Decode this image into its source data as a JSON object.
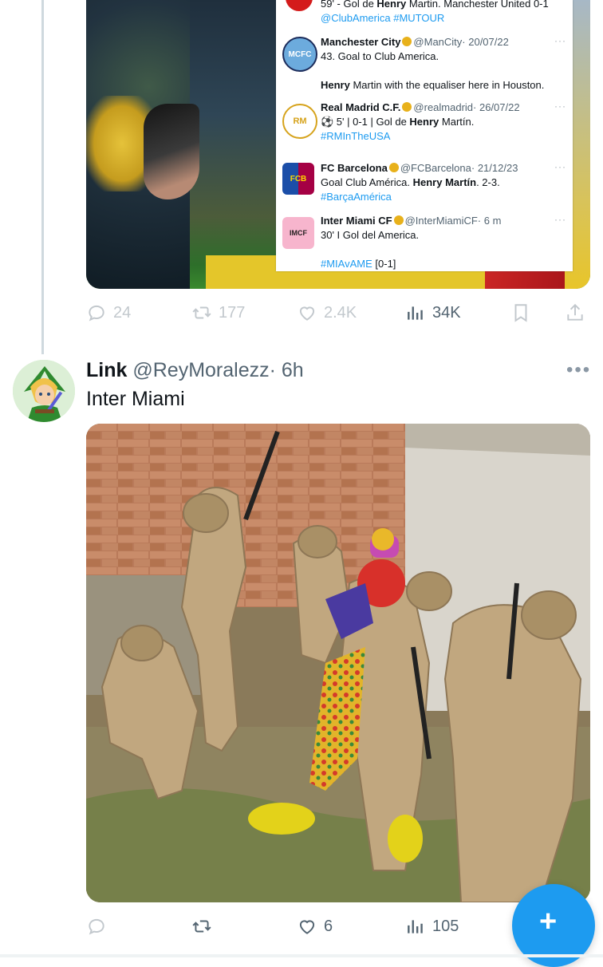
{
  "embedded_card": {
    "posts": [
      {
        "line1_prefix": "59' - Gol de ",
        "line1_bold": "Henry",
        "line1_rest": " Martin. Manchester United 0-1",
        "line2": "@ClubAmerica #MUTOUR"
      },
      {
        "logo_text": "MCFC",
        "name": "Manchester City",
        "handle": "@ManCity",
        "date": "· 20/07/22",
        "dots": "···",
        "line1": "43. Goal to Club America.",
        "line2_bold": "Henry",
        "line2_rest": " Martin with the equaliser here in Houston."
      },
      {
        "logo_text": "RM",
        "name": "Real Madrid C.F.",
        "handle": "@realmadrid",
        "date": "· 26/07/22",
        "dots": "···",
        "line1_prefix": "⚽ 5' | 0-1 | Gol de ",
        "line1_bold": "Henry",
        "line1_rest": " Martín.",
        "line2": "#RMInTheUSA"
      },
      {
        "logo_text": "FCB",
        "name": "FC Barcelona",
        "handle": "@FCBarcelona",
        "date": "· 21/12/23",
        "dots": "···",
        "line1_prefix": "Goal Club América. ",
        "line1_bold": "Henry Martín",
        "line1_rest": ". 2-3.",
        "line2": "#BarçaAmérica"
      },
      {
        "logo_text": "IMCF",
        "name": "Inter Miami CF",
        "handle": "@InterMiamiCF",
        "date": "· 6 m",
        "dots": "···",
        "line1": "30' I Gol del America.",
        "line2_blue": "#MIAvAME",
        "line2_rest": " [0-1]"
      }
    ]
  },
  "tweet1_actions": {
    "replies": "24",
    "retweets": "177",
    "likes": "2.4K",
    "views": "34K"
  },
  "tweet2": {
    "name": "Link",
    "handle": "@ReyMoralezz",
    "time": "· 6h",
    "more": "•••",
    "text": "Inter Miami"
  },
  "tweet2_actions": {
    "replies": "",
    "retweets": "",
    "likes": "6",
    "views": "105"
  },
  "fab": {
    "label": "+"
  },
  "colors": {
    "accent": "#1d9bf0",
    "muted": "#536471",
    "text": "#0f1419"
  }
}
